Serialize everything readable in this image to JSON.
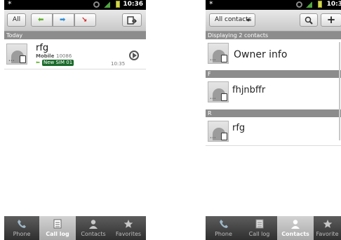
{
  "left": {
    "status": {
      "time": "10:36"
    },
    "toolbar": {
      "filter_label": "All"
    },
    "section_today": "Today",
    "call": {
      "name": "rfg",
      "type": "Mobile",
      "number": "10086",
      "sim": "New SIM 01",
      "time": "10:35"
    },
    "tabs": [
      {
        "label": "Phone",
        "icon": "phone-icon"
      },
      {
        "label": "Call log",
        "icon": "call-log-icon"
      },
      {
        "label": "Contacts",
        "icon": "contacts-icon"
      },
      {
        "label": "Favorites",
        "icon": "star-icon"
      }
    ]
  },
  "right": {
    "status": {
      "time": "10:3"
    },
    "toolbar": {
      "filter_label": "All contacts"
    },
    "displaying": "Displaying 2 contacts",
    "owner": "Owner info",
    "sections": [
      {
        "letter": "F",
        "name": "fhjnbffr"
      },
      {
        "letter": "R",
        "name": "rfg"
      }
    ],
    "tabs": [
      {
        "label": "Phone",
        "icon": "phone-icon"
      },
      {
        "label": "Call log",
        "icon": "call-log-icon"
      },
      {
        "label": "Contacts",
        "icon": "contacts-icon"
      },
      {
        "label": "Favorite",
        "icon": "star-icon"
      }
    ]
  },
  "colors": {
    "sim_badge": "#1a6a2a",
    "green_arrow": "#5fb32c",
    "blue_arrow": "#2f8fd8",
    "red_arrow": "#d32424"
  }
}
